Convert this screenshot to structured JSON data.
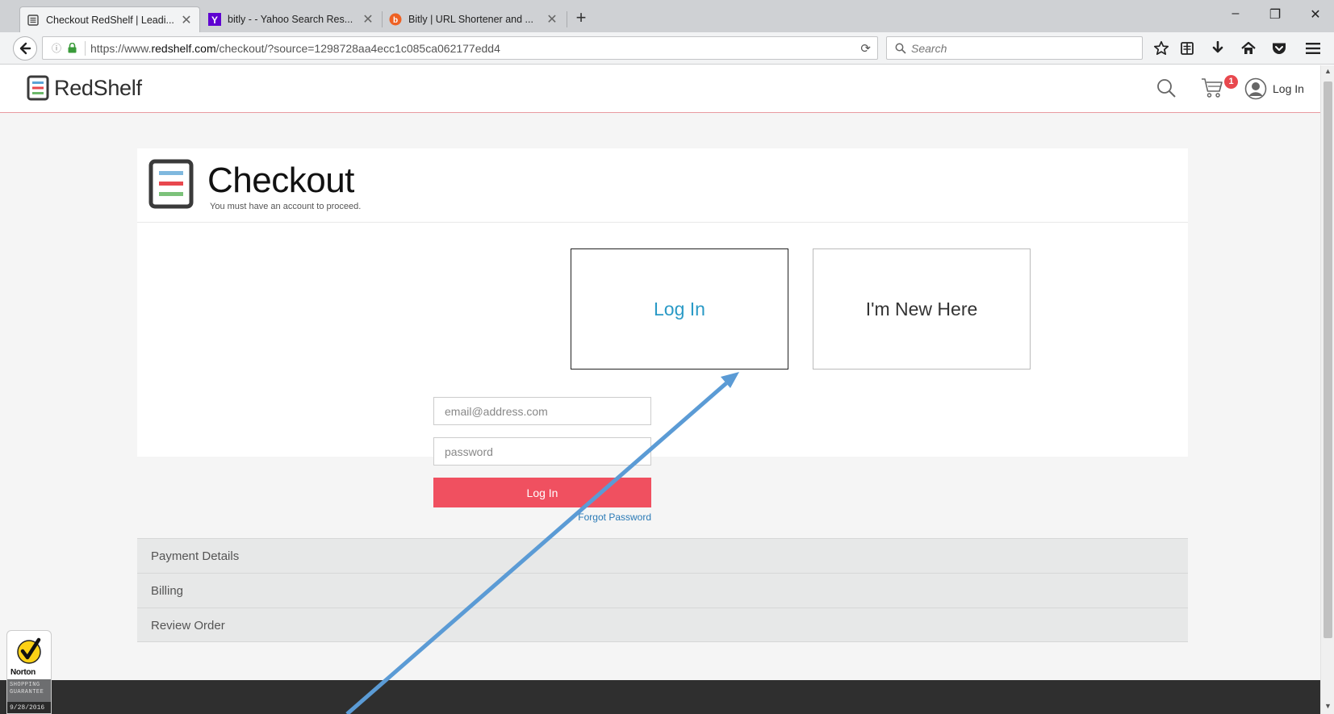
{
  "browser": {
    "tabs": [
      {
        "label": "Checkout RedShelf | Leadi...",
        "icon": "redshelf-favicon",
        "active": true
      },
      {
        "label": "bitly - - Yahoo Search Res...",
        "icon": "yahoo-favicon",
        "active": false
      },
      {
        "label": "Bitly | URL Shortener and ...",
        "icon": "bitly-favicon",
        "active": false
      }
    ],
    "tab_close": "✕",
    "new_tab": "+",
    "window": {
      "minimize": "–",
      "restore": "❐",
      "close": "✕"
    },
    "url_prefix": "https://www.",
    "url_domain": "redshelf.com",
    "url_path": "/checkout/?source=1298728aa4ecc1c085ca062177edd4",
    "search_placeholder": "Search",
    "toolbar_icons": [
      "star-icon",
      "reading-list-icon",
      "download-icon",
      "home-icon",
      "pocket-icon",
      "menu-icon"
    ]
  },
  "site": {
    "logo_text": "RedShelf",
    "cart_count": "1",
    "login_label": "Log In",
    "accent": "#f05060",
    "link_color": "#2a9ac6"
  },
  "checkout": {
    "title": "Checkout",
    "subtitle": "You must have an account to proceed.",
    "login_choice": "Log In",
    "new_choice": "I'm New Here",
    "email_placeholder": "email@address.com",
    "password_placeholder": "password",
    "login_button": "Log In",
    "forgot_password": "Forgot Password"
  },
  "sections": [
    "Payment Details",
    "Billing",
    "Review Order"
  ],
  "norton": {
    "brand": "Norton",
    "line1": "SHOPPING",
    "line2": "GUARANTEE",
    "date": "9/28/2016"
  }
}
